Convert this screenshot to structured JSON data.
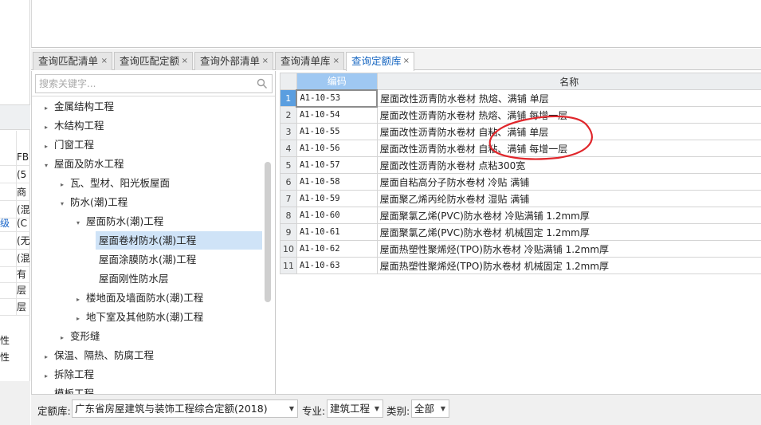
{
  "left_strip": {
    "cells": [
      "FB",
      "(5",
      "商",
      "(混",
      "(C",
      "(无",
      "(混",
      "有",
      "层",
      "层"
    ],
    "link_cell": "级",
    "lower_cells": [
      "性",
      "性"
    ]
  },
  "tabs": [
    {
      "label": "查询匹配清单",
      "active": false
    },
    {
      "label": "查询匹配定额",
      "active": false
    },
    {
      "label": "查询外部清单",
      "active": false
    },
    {
      "label": "查询清单库",
      "active": false
    },
    {
      "label": "查询定额库",
      "active": true
    }
  ],
  "tab_close_glyph": "×",
  "search": {
    "placeholder": "搜索关键字..."
  },
  "tree": [
    {
      "label": "金属结构工程",
      "arrow": "▸",
      "level": 0
    },
    {
      "label": "木结构工程",
      "arrow": "▸",
      "level": 0
    },
    {
      "label": "门窗工程",
      "arrow": "▸",
      "level": 0
    },
    {
      "label": "屋面及防水工程",
      "arrow": "▾",
      "level": 0
    },
    {
      "label": "瓦、型材、阳光板屋面",
      "arrow": "▸",
      "level": 1
    },
    {
      "label": "防水(潮)工程",
      "arrow": "▾",
      "level": 1
    },
    {
      "label": "屋面防水(潮)工程",
      "arrow": "▾",
      "level": 2
    },
    {
      "label": "屋面卷材防水(潮)工程",
      "arrow": "",
      "level": 3,
      "selected": true
    },
    {
      "label": "屋面涂膜防水(潮)工程",
      "arrow": "",
      "level": 3
    },
    {
      "label": "屋面刚性防水层",
      "arrow": "",
      "level": 3
    },
    {
      "label": "楼地面及墙面防水(潮)工程",
      "arrow": "▸",
      "level": 2
    },
    {
      "label": "地下室及其他防水(潮)工程",
      "arrow": "▸",
      "level": 2
    },
    {
      "label": "变形缝",
      "arrow": "▸",
      "level": 1
    },
    {
      "label": "保温、隔热、防腐工程",
      "arrow": "▸",
      "level": 0
    },
    {
      "label": "拆除工程",
      "arrow": "▸",
      "level": 0
    },
    {
      "label": "模板工程",
      "arrow": "▸",
      "level": 0
    }
  ],
  "grid": {
    "headers": {
      "code": "编码",
      "name": "名称"
    },
    "rows": [
      {
        "no": "1",
        "code": "A1-10-53",
        "name": "屋面改性沥青防水卷材 热熔、满铺 单层"
      },
      {
        "no": "2",
        "code": "A1-10-54",
        "name": "屋面改性沥青防水卷材 热熔、满铺 每增一层"
      },
      {
        "no": "3",
        "code": "A1-10-55",
        "name": "屋面改性沥青防水卷材 自粘、满铺 单层"
      },
      {
        "no": "4",
        "code": "A1-10-56",
        "name": "屋面改性沥青防水卷材 自粘、满铺 每增一层"
      },
      {
        "no": "5",
        "code": "A1-10-57",
        "name": "屋面改性沥青防水卷材 点粘300宽"
      },
      {
        "no": "6",
        "code": "A1-10-58",
        "name": "屋面自粘高分子防水卷材 冷贴 满铺"
      },
      {
        "no": "7",
        "code": "A1-10-59",
        "name": "屋面聚乙烯丙纶防水卷材 湿贴 满铺"
      },
      {
        "no": "8",
        "code": "A1-10-60",
        "name": "屋面聚氯乙烯(PVC)防水卷材 冷贴满铺 1.2mm厚"
      },
      {
        "no": "9",
        "code": "A1-10-61",
        "name": "屋面聚氯乙烯(PVC)防水卷材 机械固定 1.2mm厚"
      },
      {
        "no": "10",
        "code": "A1-10-62",
        "name": "屋面热塑性聚烯烃(TPO)防水卷材 冷贴满铺 1.2mm厚"
      },
      {
        "no": "11",
        "code": "A1-10-63",
        "name": "屋面热塑性聚烯烃(TPO)防水卷材 机械固定 1.2mm厚"
      }
    ]
  },
  "footer": {
    "quota_label": "定额库:",
    "quota_value": "广东省房屋建筑与装饰工程综合定额(2018)",
    "major_label": "专业:",
    "major_value": "建筑工程",
    "category_label": "类别:",
    "category_value": "全部"
  },
  "colors": {
    "accent": "#1565c0",
    "header_selected": "#9fc8f2",
    "row_selected": "#5a9ee0",
    "tree_selected": "#cfe3f7",
    "annotation": "#e0262b"
  },
  "icons": {
    "search": "search-icon",
    "dropdown": "chevron-down-icon",
    "close": "close-icon"
  }
}
